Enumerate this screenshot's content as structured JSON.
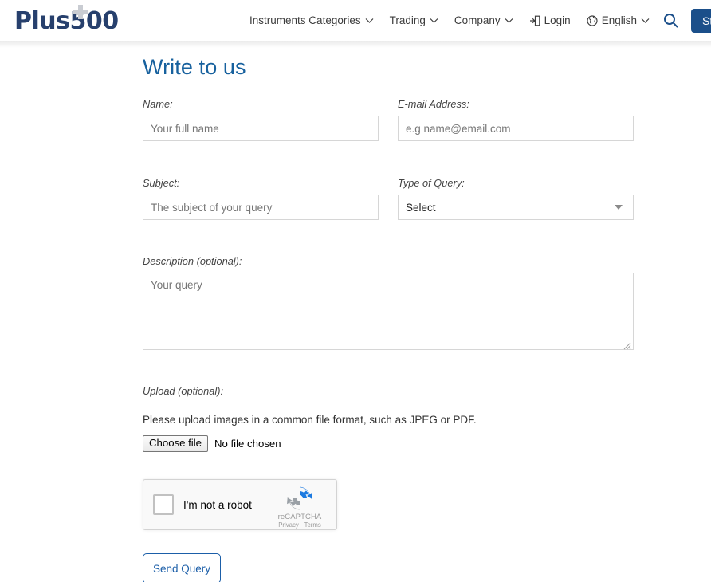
{
  "header": {
    "logo_text": "Plus500",
    "logo_plus_icon": "plus-icon",
    "nav": [
      {
        "label": "Instruments Categories",
        "icon": "",
        "chevron": "⌄"
      },
      {
        "label": "Trading",
        "icon": "",
        "chevron": "⌄"
      },
      {
        "label": "Company",
        "icon": "",
        "chevron": "⌄"
      },
      {
        "label": "Login",
        "icon": "login-door-icon",
        "chevron": ""
      },
      {
        "label": "English",
        "icon": "globe-icon",
        "chevron": "⌄"
      }
    ],
    "search_icon": "search-icon",
    "start_button_label": "Sta",
    "start_button_color": "#1b4f8a"
  },
  "form": {
    "title": "Write to us",
    "title_color": "#17619e",
    "name": {
      "label": "Name:",
      "value": "",
      "placeholder": "Your full name"
    },
    "email": {
      "label": "E-mail Address:",
      "value": "",
      "placeholder": "e.g name@email.com"
    },
    "subject": {
      "label": "Subject:",
      "value": "",
      "placeholder": "The subject of your query"
    },
    "type_of_query": {
      "label": "Type of Query:",
      "selected": "Select",
      "arrow_icon": "chevron-down-icon"
    },
    "description": {
      "label": "Description (optional):",
      "value": "",
      "placeholder": "Your query"
    },
    "upload": {
      "label": "Upload (optional):",
      "note": "Please upload images in a common file format, such as JPEG or PDF.",
      "choose_file_label": "Choose file",
      "no_file_label": "No file chosen"
    },
    "recaptcha": {
      "checkbox_label": "I'm not a robot",
      "brand": "reCAPTCHA",
      "privacy": "Privacy",
      "separator": "·",
      "terms": "Terms",
      "logo_icon": "recaptcha-logo-icon"
    },
    "submit_label": "Send Query",
    "submit_color": "#1b5ea8"
  }
}
